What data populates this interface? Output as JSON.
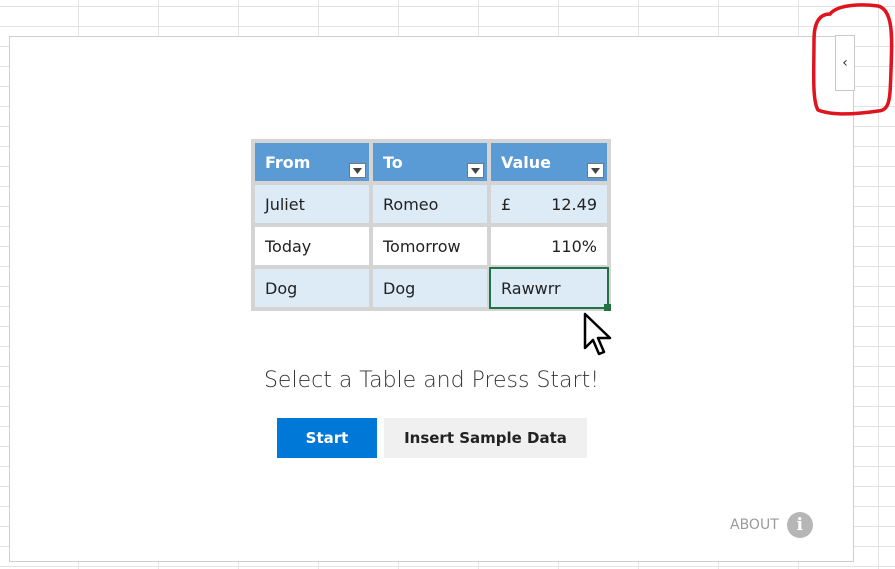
{
  "collapse_button": {
    "glyph": "‹"
  },
  "illustration": {
    "headers": [
      "From",
      "To",
      "Value"
    ],
    "rows": [
      {
        "from": "Juliet",
        "to": "Romeo",
        "currency_symbol": "£",
        "value": "12.49"
      },
      {
        "from": "Today",
        "to": "Tomorrow",
        "value": "110%"
      },
      {
        "from": "Dog",
        "to": "Dog",
        "value": "Rawwrr"
      }
    ],
    "header_color": "#5b9bd5",
    "band_color": "#ddebf7",
    "selection_color": "#217346"
  },
  "instruction": "Select a Table and Press Start!",
  "buttons": {
    "start_label": "Start",
    "sample_label": "Insert Sample Data"
  },
  "about": {
    "label": "ABOUT",
    "icon": "i"
  },
  "colors": {
    "primary": "#0078d7",
    "annotation": "#e0141e"
  }
}
